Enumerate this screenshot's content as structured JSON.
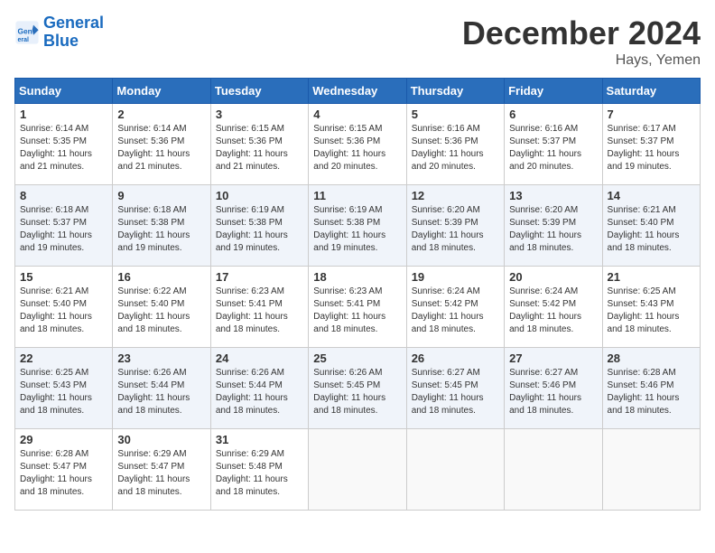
{
  "header": {
    "logo_line1": "General",
    "logo_line2": "Blue",
    "month_title": "December 2024",
    "location": "Hays, Yemen"
  },
  "weekdays": [
    "Sunday",
    "Monday",
    "Tuesday",
    "Wednesday",
    "Thursday",
    "Friday",
    "Saturday"
  ],
  "weeks": [
    [
      {
        "day": "1",
        "sunrise": "6:14 AM",
        "sunset": "5:35 PM",
        "daylight": "11 hours and 21 minutes."
      },
      {
        "day": "2",
        "sunrise": "6:14 AM",
        "sunset": "5:36 PM",
        "daylight": "11 hours and 21 minutes."
      },
      {
        "day": "3",
        "sunrise": "6:15 AM",
        "sunset": "5:36 PM",
        "daylight": "11 hours and 21 minutes."
      },
      {
        "day": "4",
        "sunrise": "6:15 AM",
        "sunset": "5:36 PM",
        "daylight": "11 hours and 20 minutes."
      },
      {
        "day": "5",
        "sunrise": "6:16 AM",
        "sunset": "5:36 PM",
        "daylight": "11 hours and 20 minutes."
      },
      {
        "day": "6",
        "sunrise": "6:16 AM",
        "sunset": "5:37 PM",
        "daylight": "11 hours and 20 minutes."
      },
      {
        "day": "7",
        "sunrise": "6:17 AM",
        "sunset": "5:37 PM",
        "daylight": "11 hours and 19 minutes."
      }
    ],
    [
      {
        "day": "8",
        "sunrise": "6:18 AM",
        "sunset": "5:37 PM",
        "daylight": "11 hours and 19 minutes."
      },
      {
        "day": "9",
        "sunrise": "6:18 AM",
        "sunset": "5:38 PM",
        "daylight": "11 hours and 19 minutes."
      },
      {
        "day": "10",
        "sunrise": "6:19 AM",
        "sunset": "5:38 PM",
        "daylight": "11 hours and 19 minutes."
      },
      {
        "day": "11",
        "sunrise": "6:19 AM",
        "sunset": "5:38 PM",
        "daylight": "11 hours and 19 minutes."
      },
      {
        "day": "12",
        "sunrise": "6:20 AM",
        "sunset": "5:39 PM",
        "daylight": "11 hours and 18 minutes."
      },
      {
        "day": "13",
        "sunrise": "6:20 AM",
        "sunset": "5:39 PM",
        "daylight": "11 hours and 18 minutes."
      },
      {
        "day": "14",
        "sunrise": "6:21 AM",
        "sunset": "5:40 PM",
        "daylight": "11 hours and 18 minutes."
      }
    ],
    [
      {
        "day": "15",
        "sunrise": "6:21 AM",
        "sunset": "5:40 PM",
        "daylight": "11 hours and 18 minutes."
      },
      {
        "day": "16",
        "sunrise": "6:22 AM",
        "sunset": "5:40 PM",
        "daylight": "11 hours and 18 minutes."
      },
      {
        "day": "17",
        "sunrise": "6:23 AM",
        "sunset": "5:41 PM",
        "daylight": "11 hours and 18 minutes."
      },
      {
        "day": "18",
        "sunrise": "6:23 AM",
        "sunset": "5:41 PM",
        "daylight": "11 hours and 18 minutes."
      },
      {
        "day": "19",
        "sunrise": "6:24 AM",
        "sunset": "5:42 PM",
        "daylight": "11 hours and 18 minutes."
      },
      {
        "day": "20",
        "sunrise": "6:24 AM",
        "sunset": "5:42 PM",
        "daylight": "11 hours and 18 minutes."
      },
      {
        "day": "21",
        "sunrise": "6:25 AM",
        "sunset": "5:43 PM",
        "daylight": "11 hours and 18 minutes."
      }
    ],
    [
      {
        "day": "22",
        "sunrise": "6:25 AM",
        "sunset": "5:43 PM",
        "daylight": "11 hours and 18 minutes."
      },
      {
        "day": "23",
        "sunrise": "6:26 AM",
        "sunset": "5:44 PM",
        "daylight": "11 hours and 18 minutes."
      },
      {
        "day": "24",
        "sunrise": "6:26 AM",
        "sunset": "5:44 PM",
        "daylight": "11 hours and 18 minutes."
      },
      {
        "day": "25",
        "sunrise": "6:26 AM",
        "sunset": "5:45 PM",
        "daylight": "11 hours and 18 minutes."
      },
      {
        "day": "26",
        "sunrise": "6:27 AM",
        "sunset": "5:45 PM",
        "daylight": "11 hours and 18 minutes."
      },
      {
        "day": "27",
        "sunrise": "6:27 AM",
        "sunset": "5:46 PM",
        "daylight": "11 hours and 18 minutes."
      },
      {
        "day": "28",
        "sunrise": "6:28 AM",
        "sunset": "5:46 PM",
        "daylight": "11 hours and 18 minutes."
      }
    ],
    [
      {
        "day": "29",
        "sunrise": "6:28 AM",
        "sunset": "5:47 PM",
        "daylight": "11 hours and 18 minutes."
      },
      {
        "day": "30",
        "sunrise": "6:29 AM",
        "sunset": "5:47 PM",
        "daylight": "11 hours and 18 minutes."
      },
      {
        "day": "31",
        "sunrise": "6:29 AM",
        "sunset": "5:48 PM",
        "daylight": "11 hours and 18 minutes."
      },
      null,
      null,
      null,
      null
    ]
  ]
}
